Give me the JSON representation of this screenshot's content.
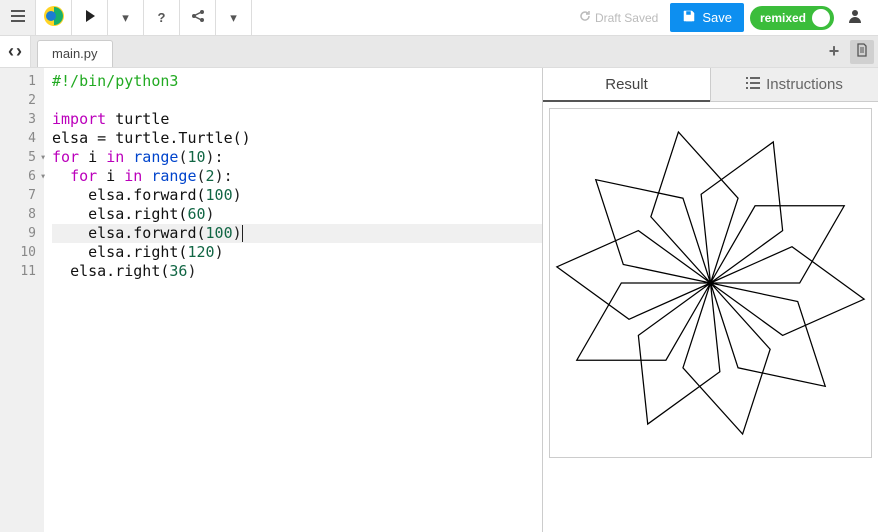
{
  "topbar": {
    "draft_saved": "Draft Saved",
    "save_label": "Save",
    "remixed_label": "remixed"
  },
  "subbar": {
    "file_tab": "main.py"
  },
  "editor": {
    "line_numbers": [
      "1",
      "2",
      "3",
      "4",
      "5",
      "6",
      "7",
      "8",
      "9",
      "10",
      "11"
    ],
    "fold_lines": [
      5,
      6
    ],
    "highlighted_line": 9,
    "code": {
      "l1": "#!/bin/python3",
      "l3_import": "import",
      "l3_mod": " turtle",
      "l4": "elsa = turtle.Turtle()",
      "l5_for": "for",
      "l5_i": " i ",
      "l5_in": "in",
      "l5_range": " range",
      "l5_n": "10",
      "l6_for": "for",
      "l6_i": " i ",
      "l6_in": "in",
      "l6_range": " range",
      "l6_n": "2",
      "l7_call": "elsa.forward(",
      "l7_n": "100",
      "l8_call": "elsa.right(",
      "l8_n": "60",
      "l9_call": "elsa.forward(",
      "l9_n": "100",
      "l10_call": "elsa.right(",
      "l10_n": "120",
      "l11_call": "elsa.right(",
      "l11_n": "36"
    }
  },
  "panel": {
    "tab_result": "Result",
    "tab_instructions": "Instructions"
  },
  "chart_data": {
    "type": "turtle-drawing",
    "description": "10-fold rotational flower/star made of rhombus petals",
    "program": {
      "outer_repeat": 10,
      "inner_repeat": 2,
      "steps": [
        {
          "op": "forward",
          "dist": 100
        },
        {
          "op": "right",
          "angle": 60
        },
        {
          "op": "forward",
          "dist": 100
        },
        {
          "op": "right",
          "angle": 120
        }
      ],
      "outer_turn": 36
    },
    "stroke": "#000000",
    "fill": "none"
  }
}
